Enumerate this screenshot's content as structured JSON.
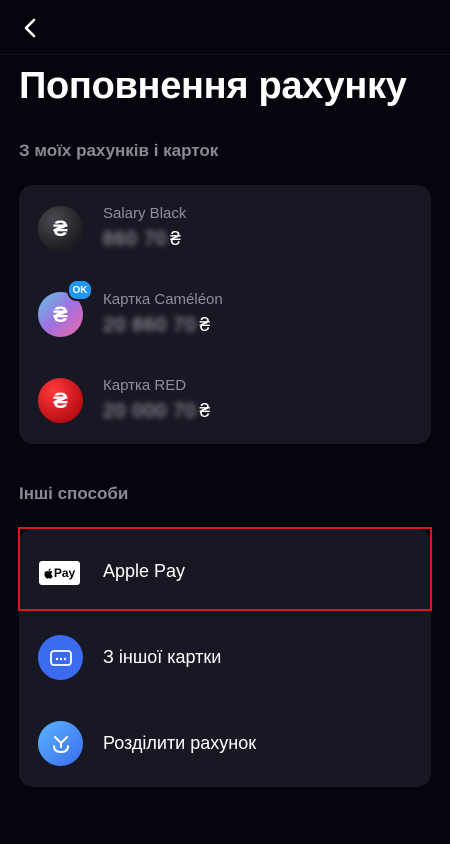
{
  "header": {
    "title": "Поповнення рахунку"
  },
  "my_accounts": {
    "section_title": "З моїх  рахунків і карток",
    "items": [
      {
        "name": "Salary Black",
        "amount_masked": "860 70",
        "currency": "₴",
        "coin_symbol": "₴"
      },
      {
        "name": "Картка Caméléon",
        "amount_masked": "20 860 70",
        "currency": "₴",
        "coin_symbol": "₴",
        "badge": "OK"
      },
      {
        "name": "Картка RED",
        "amount_masked": "20 000 70",
        "currency": "₴",
        "coin_symbol": "₴"
      }
    ]
  },
  "other_methods": {
    "section_title": "Інші способи",
    "items": [
      {
        "label": "Apple Pay",
        "icon": "apple-pay-icon",
        "badge_text": "Pay"
      },
      {
        "label": "З іншої картки",
        "icon": "card-icon"
      },
      {
        "label": "Розділити рахунок",
        "icon": "split-icon"
      }
    ]
  },
  "colors": {
    "background": "#05050d",
    "card": "#181824",
    "highlight": "#e0141e",
    "blue_icon": "#3b6cf0",
    "red_coin": "#d4141e"
  }
}
